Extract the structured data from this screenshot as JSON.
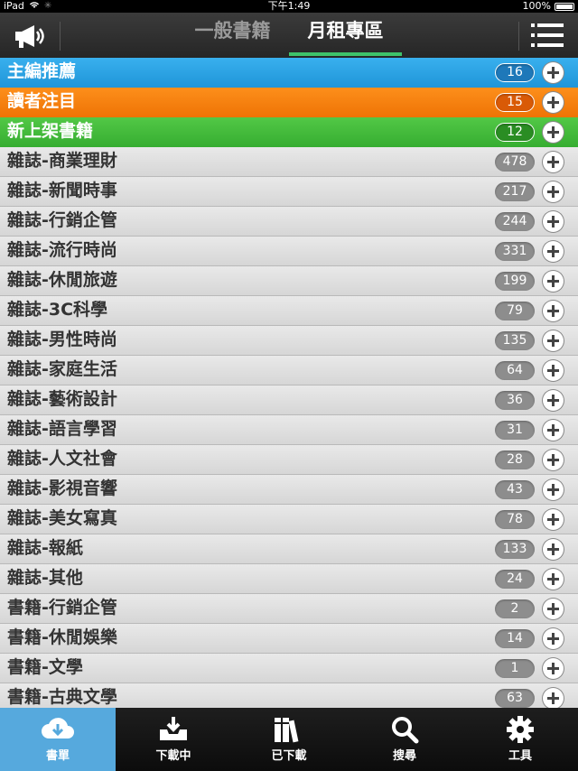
{
  "status_bar": {
    "device": "iPad",
    "time": "下午1:49",
    "battery": "100%"
  },
  "header": {
    "tabs": [
      {
        "label": "一般書籍"
      },
      {
        "label": "月租專區"
      }
    ],
    "active_tab": 1
  },
  "list": [
    {
      "label": "主編推薦",
      "count": "16",
      "style": "blue"
    },
    {
      "label": "讀者注目",
      "count": "15",
      "style": "orange"
    },
    {
      "label": "新上架書籍",
      "count": "12",
      "style": "green"
    },
    {
      "label": "雜誌-商業理財",
      "count": "478",
      "style": "gray"
    },
    {
      "label": "雜誌-新聞時事",
      "count": "217",
      "style": "gray"
    },
    {
      "label": "雜誌-行銷企管",
      "count": "244",
      "style": "gray"
    },
    {
      "label": "雜誌-流行時尚",
      "count": "331",
      "style": "gray"
    },
    {
      "label": "雜誌-休閒旅遊",
      "count": "199",
      "style": "gray"
    },
    {
      "label": "雜誌-3C科學",
      "count": "79",
      "style": "gray"
    },
    {
      "label": "雜誌-男性時尚",
      "count": "135",
      "style": "gray"
    },
    {
      "label": "雜誌-家庭生活",
      "count": "64",
      "style": "gray"
    },
    {
      "label": "雜誌-藝術設計",
      "count": "36",
      "style": "gray"
    },
    {
      "label": "雜誌-語言學習",
      "count": "31",
      "style": "gray"
    },
    {
      "label": "雜誌-人文社會",
      "count": "28",
      "style": "gray"
    },
    {
      "label": "雜誌-影視音響",
      "count": "43",
      "style": "gray"
    },
    {
      "label": "雜誌-美女寫真",
      "count": "78",
      "style": "gray"
    },
    {
      "label": "雜誌-報紙",
      "count": "133",
      "style": "gray"
    },
    {
      "label": "雜誌-其他",
      "count": "24",
      "style": "gray"
    },
    {
      "label": "書籍-行銷企管",
      "count": "2",
      "style": "gray"
    },
    {
      "label": "書籍-休閒娛樂",
      "count": "14",
      "style": "gray"
    },
    {
      "label": "書籍-文學",
      "count": "1",
      "style": "gray"
    },
    {
      "label": "書籍-古典文學",
      "count": "63",
      "style": "gray"
    }
  ],
  "tab_bar": [
    {
      "label": "書單",
      "icon": "cloud-download-icon"
    },
    {
      "label": "下載中",
      "icon": "inbox-download-icon"
    },
    {
      "label": "已下載",
      "icon": "books-icon"
    },
    {
      "label": "搜尋",
      "icon": "search-icon"
    },
    {
      "label": "工具",
      "icon": "gear-icon"
    }
  ],
  "active_bottom_tab": 0,
  "colors": {
    "accent_green": "#3ec26a",
    "active_tab_blue": "#56a9dd",
    "blue_row": "#2aa2e4",
    "orange_row": "#f7810f",
    "green_row": "#45bb3c"
  }
}
